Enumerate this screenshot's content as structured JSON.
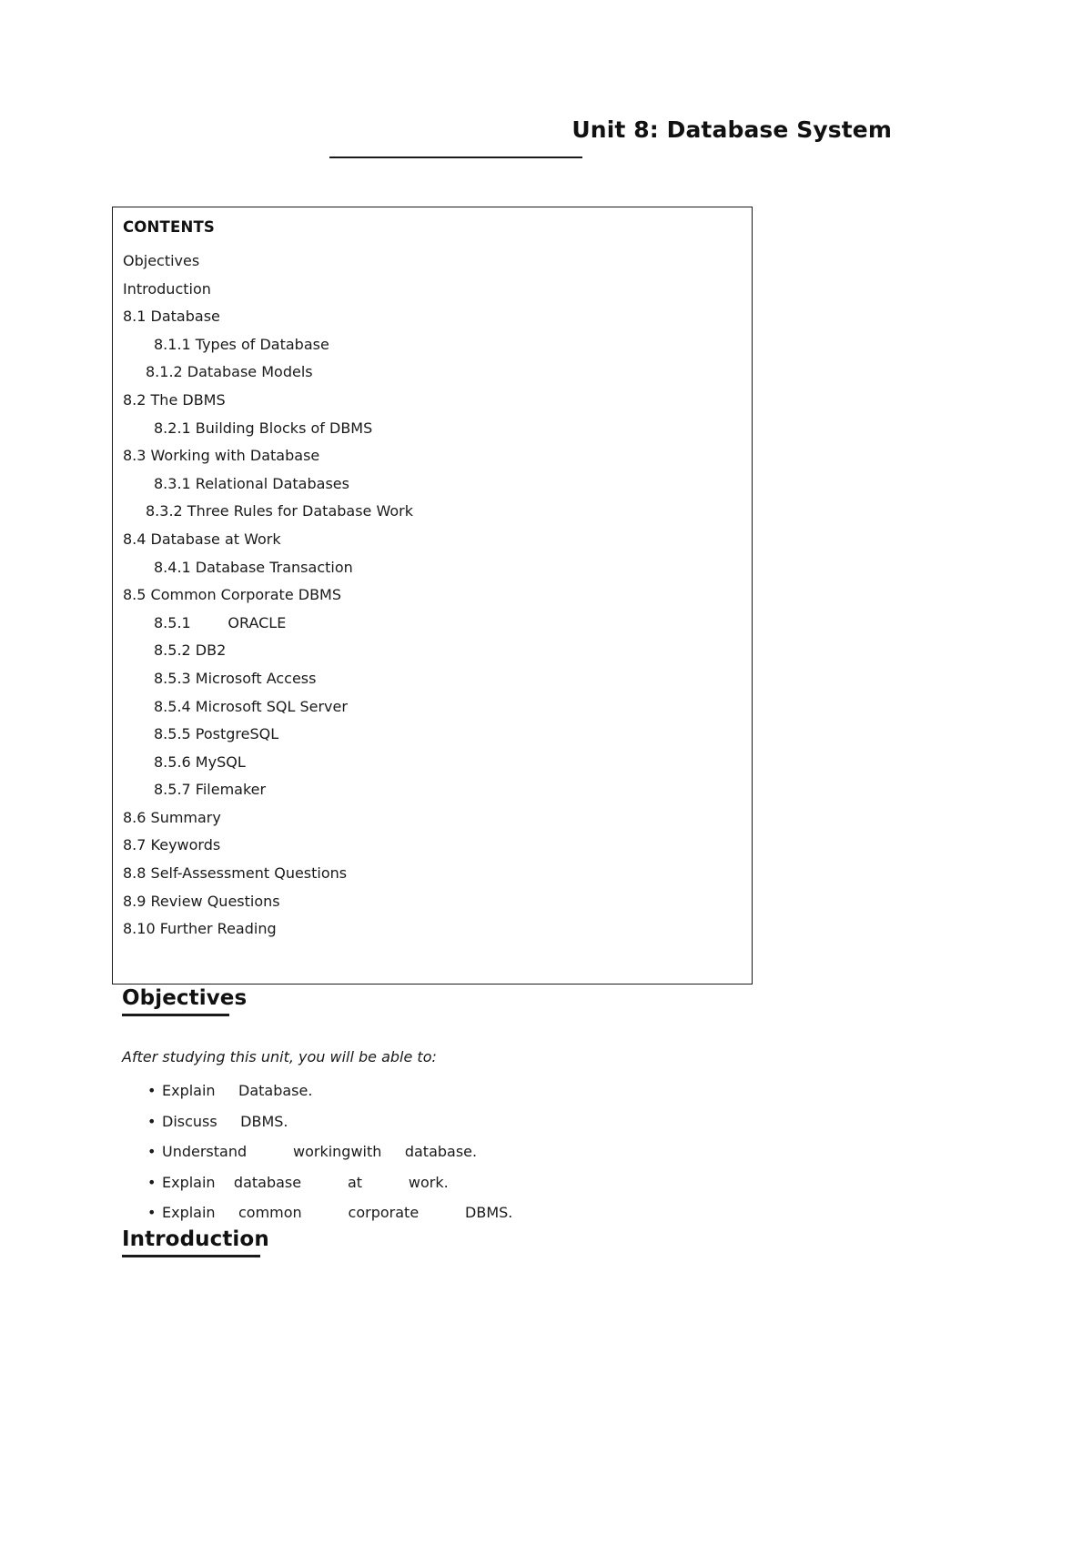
{
  "running_head": {
    "title": "Unit 8: Database System"
  },
  "contents": {
    "heading": "CONTENTS",
    "items": [
      {
        "text": "Objectives",
        "level": "lvl1"
      },
      {
        "text": "Introduction",
        "level": "lvl1"
      },
      {
        "text": "8.1 Database",
        "level": "lvl1"
      },
      {
        "text": "8.1.1 Types of Database",
        "level": "lvl2a"
      },
      {
        "text": "8.1.2 Database Models",
        "level": "lvl2b"
      },
      {
        "text": "8.2 The DBMS",
        "level": "lvl1"
      },
      {
        "text": "8.2.1 Building Blocks of DBMS",
        "level": "lvl2a"
      },
      {
        "text": "8.3 Working with Database",
        "level": "lvl1"
      },
      {
        "text": "8.3.1 Relational Databases",
        "level": "lvl2a"
      },
      {
        "text": "8.3.2 Three Rules for Database Work",
        "level": "lvl2b"
      },
      {
        "text": "8.4 Database at Work",
        "level": "lvl1"
      },
      {
        "text": "8.4.1 Database Transaction",
        "level": "lvl2a"
      },
      {
        "text": "8.5 Common Corporate DBMS",
        "level": "lvl1"
      },
      {
        "text": "8.5.1        ORACLE",
        "level": "lvl2a"
      },
      {
        "text": "8.5.2 DB2",
        "level": "lvl2a"
      },
      {
        "text": "8.5.3 Microsoft Access",
        "level": "lvl2a"
      },
      {
        "text": "8.5.4 Microsoft SQL Server",
        "level": "lvl2a"
      },
      {
        "text": "8.5.5 PostgreSQL",
        "level": "lvl2a"
      },
      {
        "text": "8.5.6 MySQL",
        "level": "lvl2a"
      },
      {
        "text": "8.5.7 Filemaker",
        "level": "lvl2a"
      },
      {
        "text": "8.6 Summary",
        "level": "lvl1"
      },
      {
        "text": "8.7 Keywords",
        "level": "lvl1"
      },
      {
        "text": "8.8 Self-Assessment Questions",
        "level": "lvl1"
      },
      {
        "text": "8.9 Review Questions",
        "level": "lvl1"
      },
      {
        "text": "8.10 Further Reading",
        "level": "lvl1"
      }
    ]
  },
  "objectives": {
    "heading": "Objectives",
    "lead": "After studying this unit, you will be able to:",
    "bullet_marker": "•",
    "bullets": [
      "Explain     Database.",
      "Discuss     DBMS.",
      "Understand          workingwith     database.",
      "Explain    database          at          work.",
      "Explain     common          corporate          DBMS."
    ]
  },
  "introduction": {
    "heading": "Introduction"
  }
}
